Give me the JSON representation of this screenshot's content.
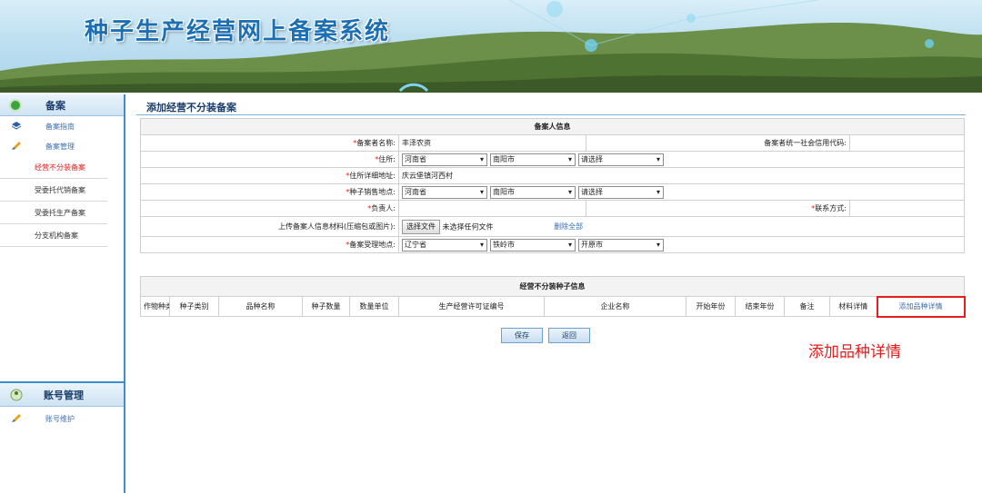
{
  "header": {
    "title": "种子生产经营网上备案系统"
  },
  "sidebar": {
    "section1_title": "备案",
    "items": [
      {
        "label": "备案指南"
      },
      {
        "label": "备案管理"
      }
    ],
    "subitems": [
      {
        "label": "经营不分装备案"
      },
      {
        "label": "受委托代销备案"
      },
      {
        "label": "受委托生产备案"
      },
      {
        "label": "分支机构备案"
      }
    ],
    "section2_title": "账号管理",
    "section2_items": [
      {
        "label": "账号维护"
      }
    ]
  },
  "page": {
    "title": "添加经营不分装备案"
  },
  "filer": {
    "section_title": "备案人信息",
    "name_label": "*备案者名称:",
    "name_value": "丰泽农资",
    "credit_label": "备案者统一社会信用代码:",
    "credit_value": "",
    "address_label": "* 住所:",
    "address": {
      "province": "河南省",
      "city": "南阳市",
      "county": "请选择"
    },
    "address_detail_label": "* 住所详细地址:",
    "address_detail_value": "庆云堡镇河西村",
    "sales_label": "* 种子销售地点:",
    "sales": {
      "province": "河南省",
      "city": "南阳市",
      "county": "请选择"
    },
    "manager_label": "* 负责人:",
    "manager_value": "",
    "contact_label": "* 联系方式:",
    "contact_value": "",
    "upload_label": "上传备案人信息材料(压缩包或图片):",
    "upload_button": "选择文件",
    "upload_status": "未选择任何文件",
    "delete_all": "删除全部",
    "office_label": "*备案受理地点:",
    "office": {
      "province": "辽宁省",
      "city": "铁岭市",
      "county": "开原市"
    }
  },
  "seeds": {
    "section_title": "经营不分装种子信息",
    "columns": [
      "作物种类",
      "种子类别",
      "品种名称",
      "种子数量",
      "数量单位",
      "生产经营许可证编号",
      "企业名称",
      "开始年份",
      "结束年份",
      "备注",
      "材料详情",
      "添加品种详情"
    ]
  },
  "actions": {
    "save": "保存",
    "back": "返回"
  },
  "annotation": {
    "text": "添加品种详情",
    "color": "#e41d1d"
  },
  "colors": {
    "accent": "#3e8fd0",
    "required": "#e02020",
    "link": "#3b6fb1"
  }
}
